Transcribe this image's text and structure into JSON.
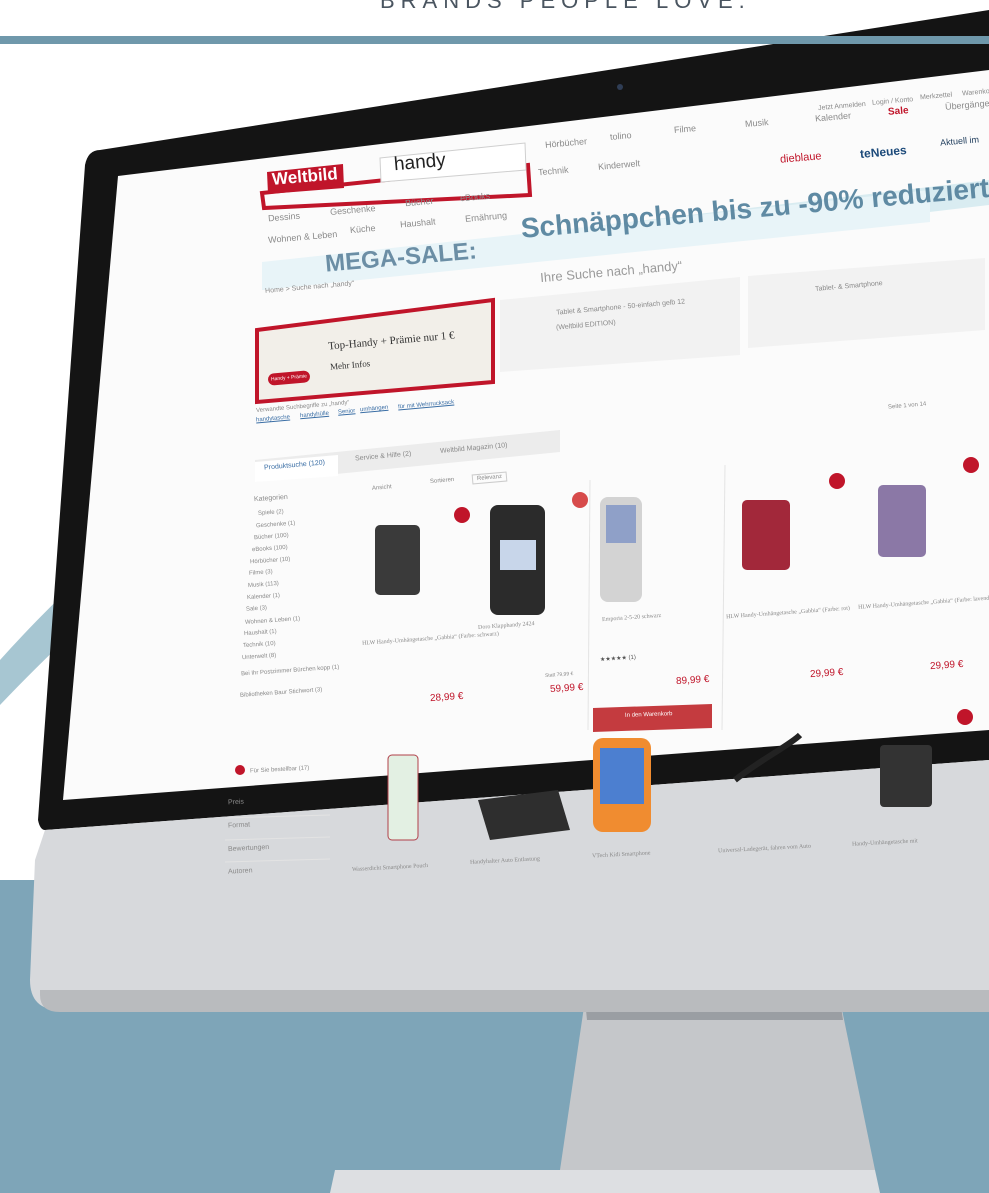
{
  "tagline": "BRANDS PEOPLE LOVE.",
  "colors": {
    "accent_red": "#c0152a",
    "steel_blue": "#7ea5b8",
    "arrow_blue": "#9cc0cd"
  },
  "site": {
    "logo": "Weltbild",
    "search_value": "handy",
    "header_icons": [
      "Jetzt Anmelden",
      "Login / Konto",
      "Merkzettel",
      "Warenkorb"
    ],
    "nav_row1": [
      "Hörbücher",
      "tolino",
      "Filme",
      "Musik",
      "Kalender",
      "Sale",
      "Übergänge"
    ],
    "nav_row2": [
      "Dessins",
      "Geschenke",
      "Bücher",
      "eBooks",
      "Technik",
      "Kinderwelt"
    ],
    "nav_row3": [
      "Wohnen & Leben",
      "Küche",
      "Haushalt",
      "Ernährung"
    ],
    "nav_brands": [
      "dieblaue",
      "teNeues",
      "Aktuell im"
    ],
    "promo_banner": "Schnäppchen bis zu -90% reduziert!",
    "mega_sale": "MEGA-SALE:",
    "breadcrumb": "Home > Suche nach „handy“",
    "search_heading": "Ihre Suche nach „handy“"
  },
  "promos": [
    {
      "title": "Top-Handy + Prämie nur 1 €",
      "link": "Mehr Infos",
      "badge": "Handy + Prämie"
    },
    {
      "title": "Tablet & Smartphone - 50-einfach gelb 12",
      "sub": "(Weltbild EDITION)"
    },
    {
      "title": "Tablet- & Smartphone"
    }
  ],
  "suggestions": {
    "label": "Verwandte Suchbegriffe zu „handy“",
    "items": [
      "handytasche",
      "handyhülle",
      "Senior",
      "umhängen",
      "für mit Wehrrucksack"
    ]
  },
  "tabs": [
    "Produktsuche (120)",
    "Service & Hilfe (2)",
    "Weltbild Magazin (10)"
  ],
  "pagination": "Seite 1 von 14",
  "toolbar": {
    "view_label": "Ansicht",
    "sort_label": "Sortieren",
    "sort_value": "Relevanz"
  },
  "sidebar": {
    "heading": "Kategorien",
    "items": [
      "Spiele (2)",
      "Geschenke (1)",
      "Bücher (100)",
      "eBooks (100)",
      "Hörbücher (10)",
      "Filme (3)",
      "Musik (113)",
      "Kalender (1)",
      "Sale (3)",
      "Wohnen & Leben (1)",
      "Haushalt (1)",
      "Technik (10)",
      "Unterwelt (8)",
      "Bei Ihr Postzimmer Bürchen kopp (1)",
      "Bibliotheken Baur Stichwort (3)"
    ],
    "footer_link": "Für Sie bestellbar (17)",
    "filters": [
      "Preis",
      "Format",
      "Bewertungen",
      "Autoren"
    ]
  },
  "products_row1": [
    {
      "name": "HLW Handy-Umhängetasche „Gabbia“ (Farbe: schwarz)",
      "price": "28,99 €",
      "stars": "",
      "sale": ""
    },
    {
      "name": "Doro Klapphandy 2424",
      "price": "59,99 €",
      "stars": "",
      "sale": "Statt 79,99 €"
    },
    {
      "name": "Emporia 2-5-20 schwarz",
      "price": "89,99 €",
      "stars": "★★★★★ (1)",
      "sale": ""
    },
    {
      "name": "HLW Handy-Umhängetasche „Gabbia“ (Farbe: rot)",
      "price": "29,99 €",
      "stars": "",
      "sale": ""
    },
    {
      "name": "HLW Handy-Umhängetasche „Gabbia“ (Farbe: lavendel)",
      "price": "29,99 €",
      "stars": "",
      "sale": ""
    }
  ],
  "cart_button": "In den Warenkorb",
  "products_row2": [
    {
      "name": "Wasserdicht Smartphone Pouch"
    },
    {
      "name": "Handyhalter Auto Entlastung"
    },
    {
      "name": "VTech Kidi Smartphone"
    },
    {
      "name": "Universal-Ladegerät, fahren vom Auto"
    },
    {
      "name": "Handy-Umhängetasche mit"
    }
  ]
}
